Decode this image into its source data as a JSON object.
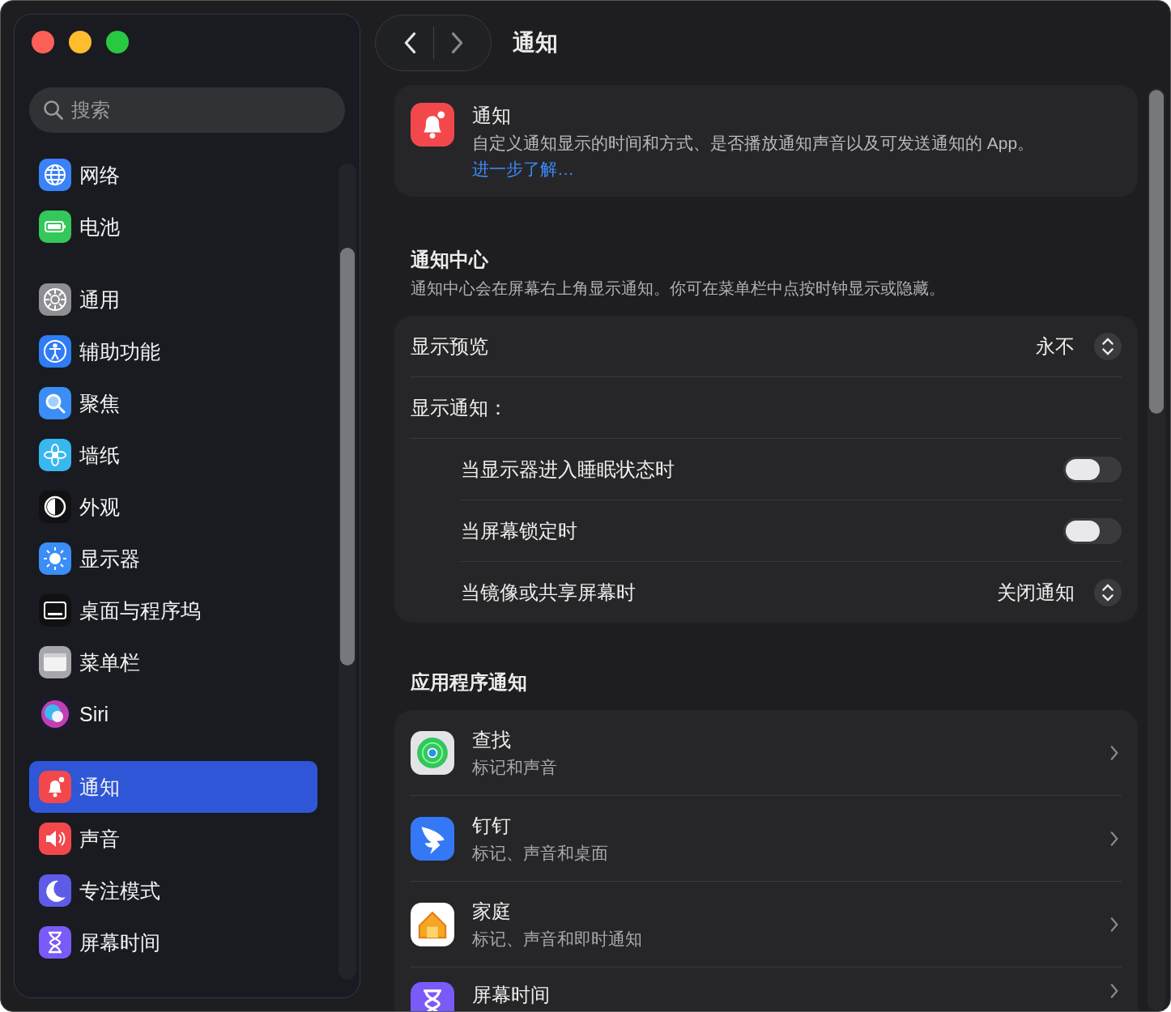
{
  "search": {
    "placeholder": "搜索"
  },
  "sidebar": {
    "groups": [
      {
        "items": [
          {
            "label": "网络",
            "kind": "globe",
            "color": "#3a82f7",
            "selected": false
          },
          {
            "label": "电池",
            "kind": "battery",
            "color": "#34c759",
            "selected": false
          }
        ]
      },
      {
        "items": [
          {
            "label": "通用",
            "kind": "gear",
            "color": "#8e8e93",
            "selected": false
          },
          {
            "label": "辅助功能",
            "kind": "accessibility",
            "color": "#2f7cf6",
            "selected": false
          },
          {
            "label": "聚焦",
            "kind": "magnifier",
            "color": "#3a8ef6",
            "selected": false
          },
          {
            "label": "墙纸",
            "kind": "flower",
            "color": "#39b7f0",
            "selected": false
          },
          {
            "label": "外观",
            "kind": "appearance",
            "color": "#111113",
            "selected": false
          },
          {
            "label": "显示器",
            "kind": "sun",
            "color": "#3a8ef6",
            "selected": false
          },
          {
            "label": "桌面与程序坞",
            "kind": "dock",
            "color": "#111113",
            "selected": false
          },
          {
            "label": "菜单栏",
            "kind": "menubar",
            "color": "#a6a6ab",
            "selected": false
          },
          {
            "label": "Siri",
            "kind": "siri",
            "color": "#1b1b2e",
            "selected": false
          }
        ]
      },
      {
        "items": [
          {
            "label": "通知",
            "kind": "bell",
            "color": "#f2484c",
            "selected": true
          },
          {
            "label": "声音",
            "kind": "speaker",
            "color": "#f2484c",
            "selected": false
          },
          {
            "label": "专注模式",
            "kind": "moon",
            "color": "#5e5ce6",
            "selected": false
          },
          {
            "label": "屏幕时间",
            "kind": "hourglass",
            "color": "#7a5af8",
            "selected": false
          }
        ]
      }
    ]
  },
  "header": {
    "title": "通知"
  },
  "intro": {
    "title": "通知",
    "description": "自定义通知显示的时间和方式、是否播放通知声音以及可发送通知的 App。",
    "link": "进一步了解…"
  },
  "notification_center": {
    "title": "通知中心",
    "description": "通知中心会在屏幕右上角显示通知。你可在菜单栏中点按时钟显示或隐藏。",
    "rows": [
      {
        "kind": "select",
        "label": "显示预览",
        "value": "永不"
      },
      {
        "kind": "group",
        "label": "显示通知：",
        "children": [
          {
            "kind": "toggle",
            "label": "当显示器进入睡眠状态时",
            "on": false
          },
          {
            "kind": "toggle",
            "label": "当屏幕锁定时",
            "on": false
          },
          {
            "kind": "select",
            "label": "当镜像或共享屏幕时",
            "value": "关闭通知"
          }
        ]
      }
    ]
  },
  "app_notifications": {
    "title": "应用程序通知",
    "apps": [
      {
        "name": "查找",
        "detail": "标记和声音",
        "kind": "find"
      },
      {
        "name": "钉钉",
        "detail": "标记、声音和桌面",
        "kind": "wing"
      },
      {
        "name": "家庭",
        "detail": "标记、声音和即时通知",
        "kind": "home"
      },
      {
        "name": "屏幕时间",
        "kind": "hourglass"
      }
    ]
  }
}
